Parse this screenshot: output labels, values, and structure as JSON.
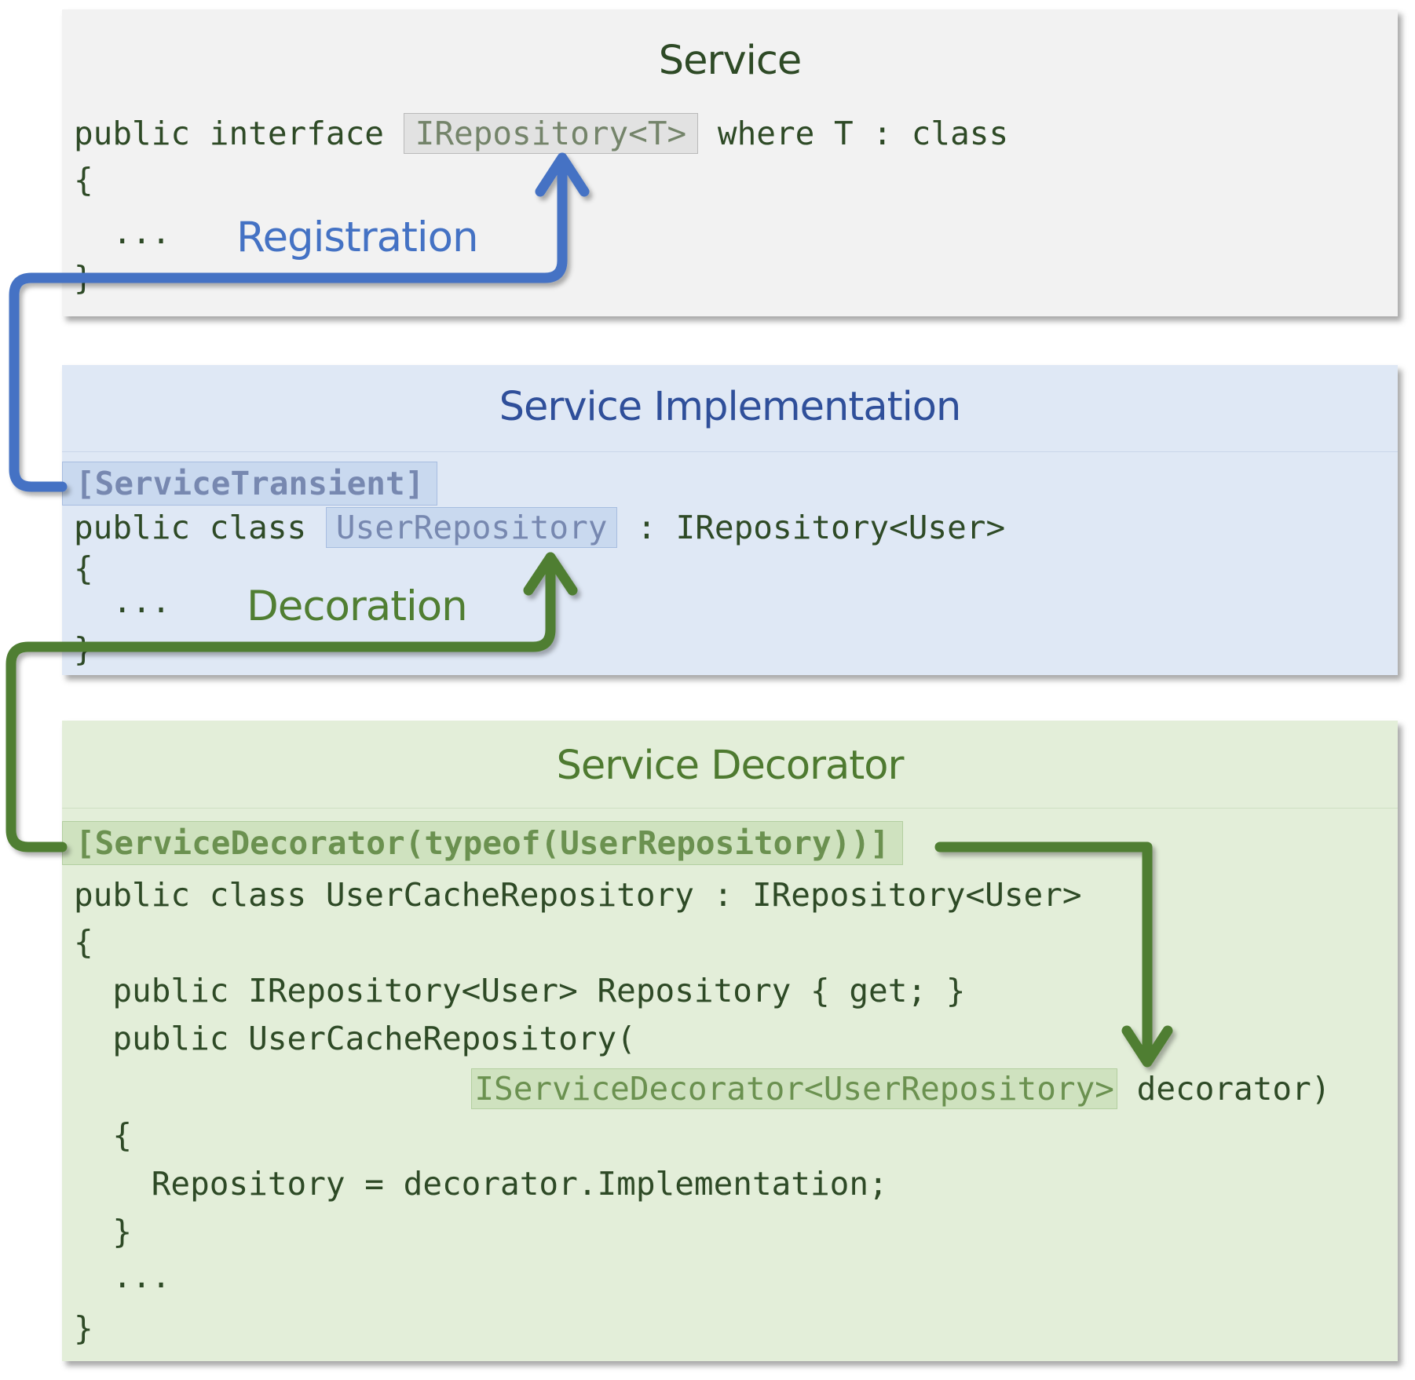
{
  "colors": {
    "registration_arrow": "#4472c4",
    "decoration_arrow": "#507e32",
    "service_bg": "#f2f2f2",
    "implementation_bg": "#dfe8f5",
    "decorator_bg": "#e3eed9"
  },
  "service": {
    "title": "Service",
    "line1_pre": "public interface ",
    "line1_hl": "IRepository<T>",
    "line1_post": " where T : class",
    "line2": "{",
    "line3": "  ...",
    "line4": "}"
  },
  "implementation": {
    "title": "Service Implementation",
    "attribute": "[ServiceTransient]",
    "line1_pre": "public class ",
    "line1_hl": "UserRepository",
    "line1_post": " : IRepository<User>",
    "line2": "{",
    "line3": "  ...",
    "line4": "}"
  },
  "decorator": {
    "title": "Service Decorator",
    "attribute": "[ServiceDecorator(typeof(UserRepository))]",
    "line1": "public class UserCacheRepository : IRepository<User>",
    "line2": "{",
    "line3": "  public IRepository<User> Repository { get; }",
    "line4": "  public UserCacheRepository(",
    "line5_indent": "                     ",
    "line5_hl": "IServiceDecorator<UserRepository>",
    "line5_post": " decorator)",
    "line6": "  {",
    "line7": "    Repository = decorator.Implementation;",
    "line8": "  }",
    "line9": "  ...",
    "line10": "}"
  },
  "labels": {
    "registration": "Registration",
    "decoration": "Decoration"
  }
}
